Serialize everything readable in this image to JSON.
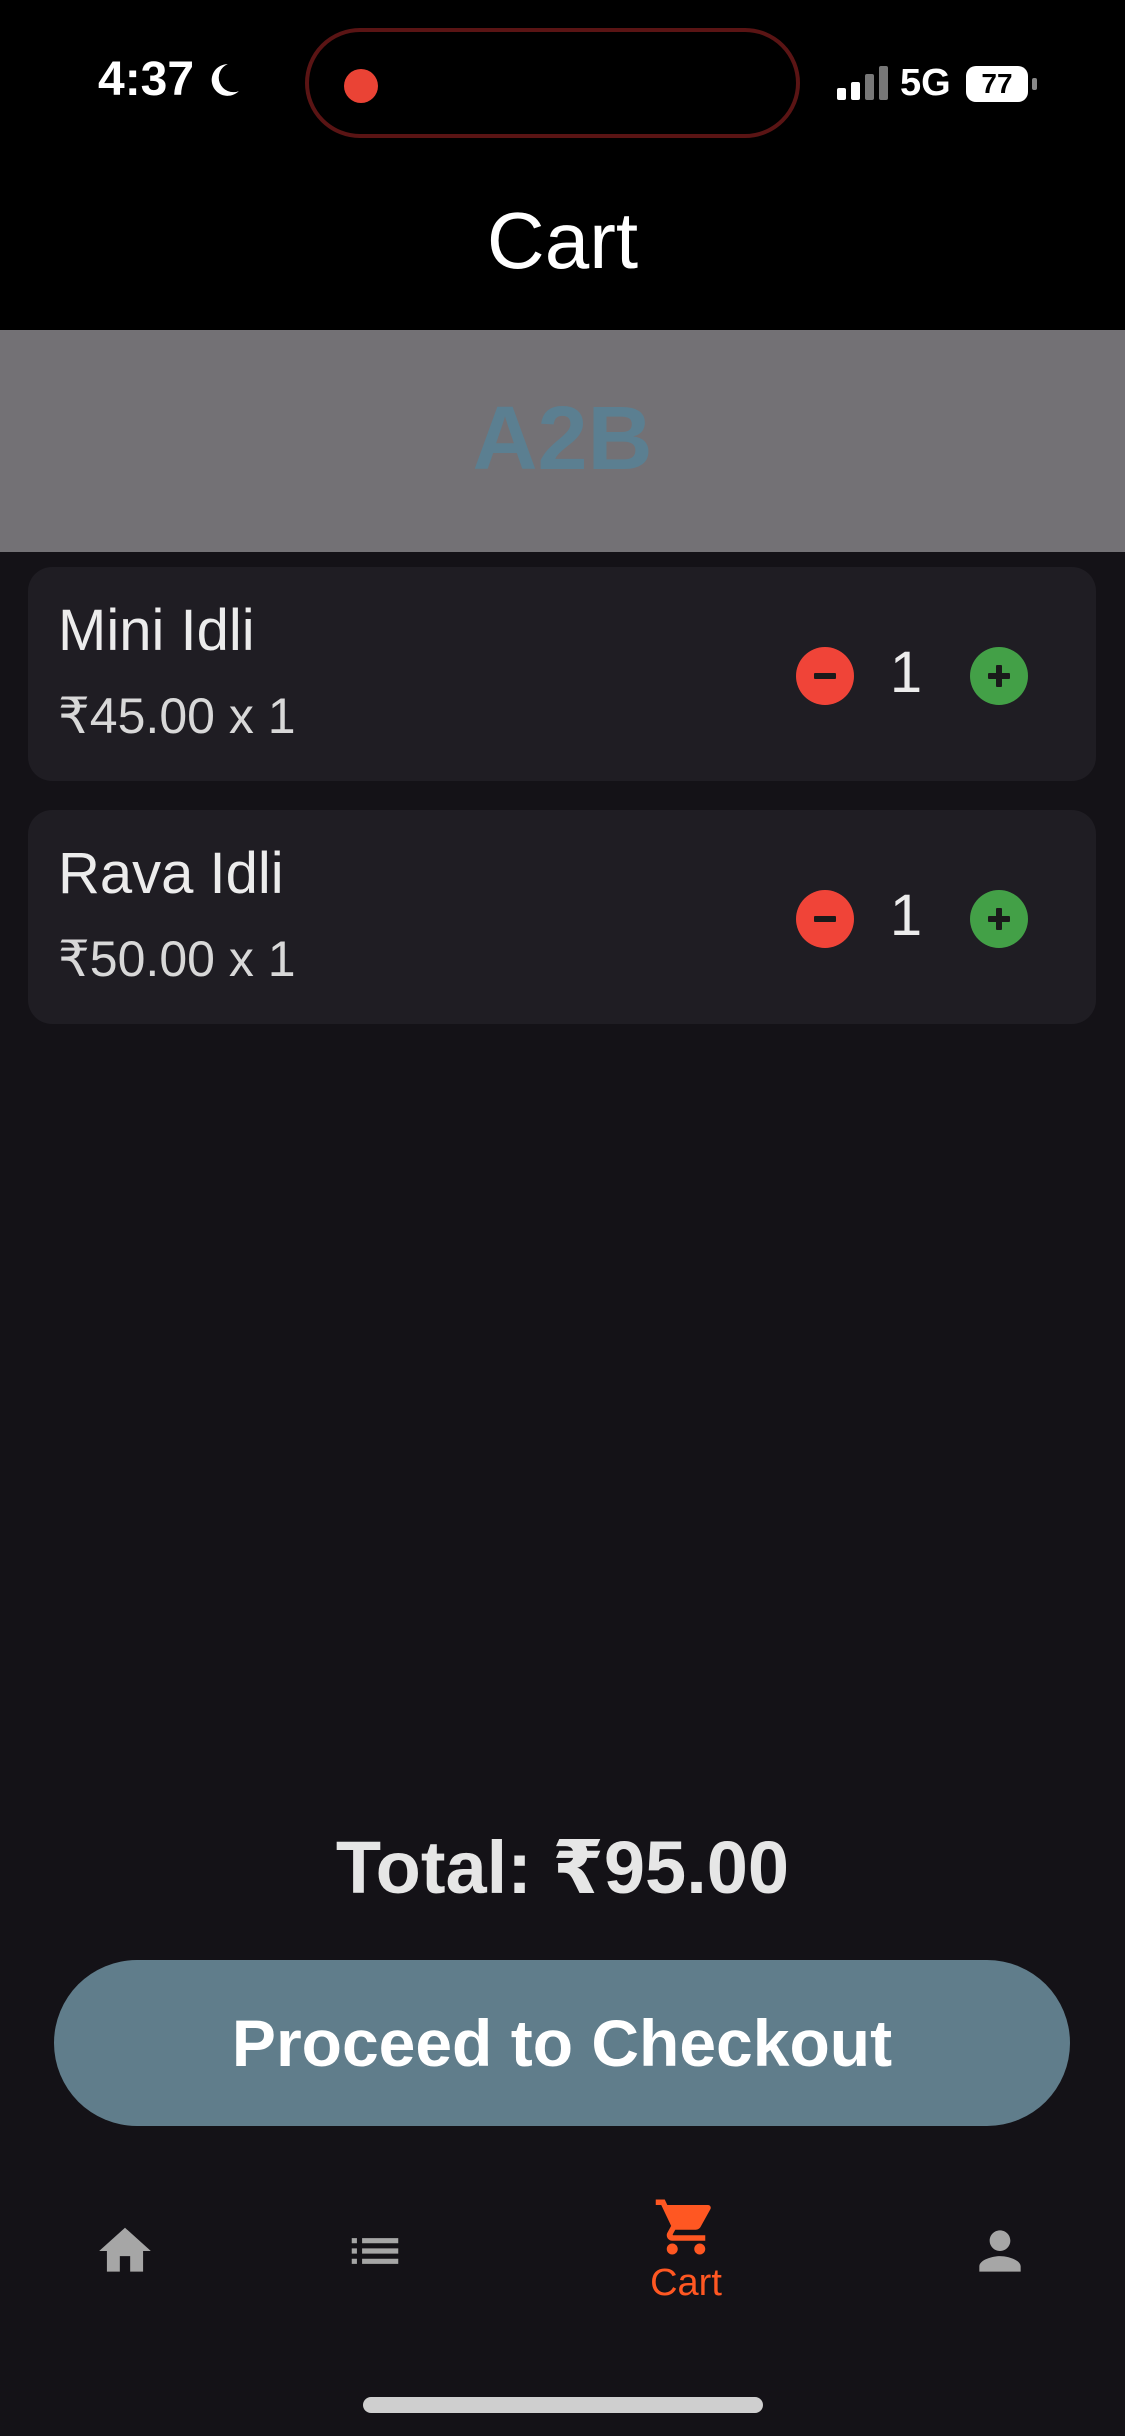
{
  "status_bar": {
    "time": "4:37",
    "network": "5G",
    "battery": "77",
    "icons": [
      "moon-icon",
      "signal-icon",
      "battery-icon"
    ],
    "recording_color": "#ea4335"
  },
  "header": {
    "title": "Cart"
  },
  "restaurant": {
    "name": "A2B"
  },
  "cart_items": [
    {
      "name": "Mini Idli",
      "price": "₹45.00 x 1",
      "quantity": "1"
    },
    {
      "name": "Rava Idli",
      "price": "₹50.00 x 1",
      "quantity": "1"
    }
  ],
  "summary": {
    "total": "Total: ₹95.00"
  },
  "actions": {
    "checkout_label": "Proceed to Checkout"
  },
  "bottom_nav": {
    "items": [
      {
        "icon": "home-icon",
        "label": ""
      },
      {
        "icon": "list-icon",
        "label": ""
      },
      {
        "icon": "cart-icon",
        "label": "Cart",
        "active": true
      },
      {
        "icon": "person-icon",
        "label": ""
      }
    ]
  },
  "colors": {
    "accent": "#ff5722",
    "checkout": "#607d8b",
    "minus": "#f04438",
    "plus": "#43a047",
    "background": "#141217",
    "card": "#1f1d23"
  }
}
